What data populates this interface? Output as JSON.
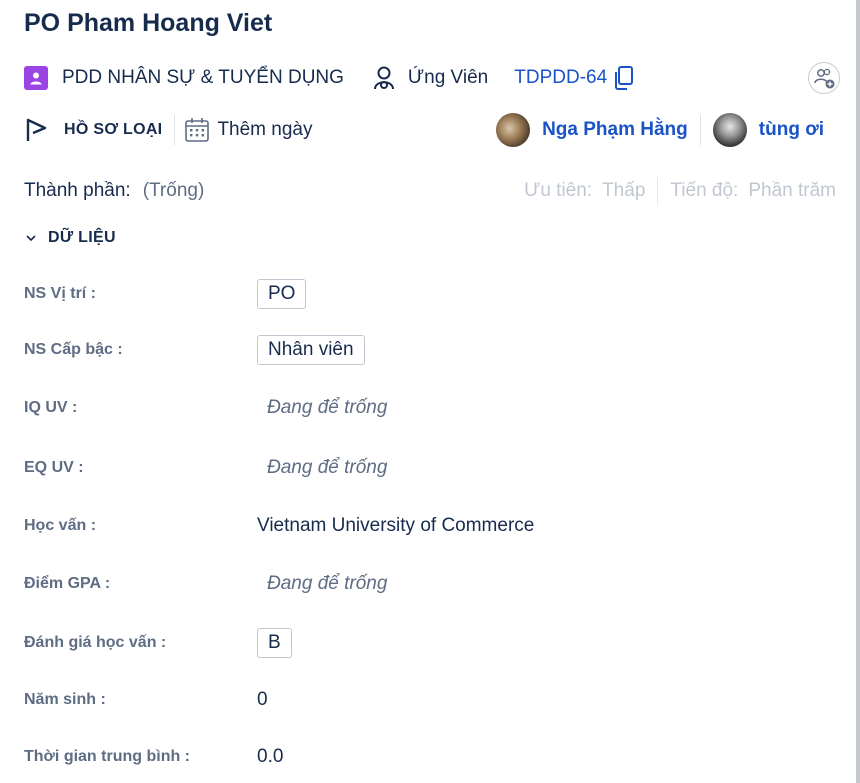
{
  "issue": {
    "title": "PO Pham Hoang Viet",
    "project": "PDD NHÂN SỰ & TUYỂN DỤNG",
    "type": "Ứng Viên",
    "key": "TDPDD-64"
  },
  "status": {
    "label": "HỒ SƠ LOẠI",
    "add_date": "Thêm ngày"
  },
  "people": [
    {
      "name": "Nga Phạm Hằng"
    },
    {
      "name": "tùng ơi"
    }
  ],
  "meta": {
    "components_label": "Thành phần:",
    "components_value": "(Trống)",
    "priority_label": "Ưu tiên:",
    "priority_value": "Thấp",
    "progress_label": "Tiến độ:",
    "progress_value": "Phần trăm"
  },
  "section": {
    "title": "DỮ LIỆU"
  },
  "fields": [
    {
      "label": "NS Vị trí :",
      "value": "PO"
    },
    {
      "label": "NS Cấp bậc :",
      "value": "Nhân viên"
    },
    {
      "label": "IQ UV :",
      "value": "Đang để trống"
    },
    {
      "label": "EQ UV :",
      "value": "Đang để trống"
    },
    {
      "label": "Học vấn :",
      "value": "Vietnam University of Commerce"
    },
    {
      "label": "Điểm GPA :",
      "value": "Đang để trống"
    },
    {
      "label": "Đánh giá học vấn :",
      "value": "B"
    },
    {
      "label": "Năm sinh :",
      "value": "0"
    },
    {
      "label": "Thời gian trung bình :",
      "value": "0.0"
    }
  ],
  "colors": {
    "project_icon": "#9b45e4",
    "link": "#1a53c8",
    "text": "#172b4d",
    "muted": "#5e6c84"
  }
}
